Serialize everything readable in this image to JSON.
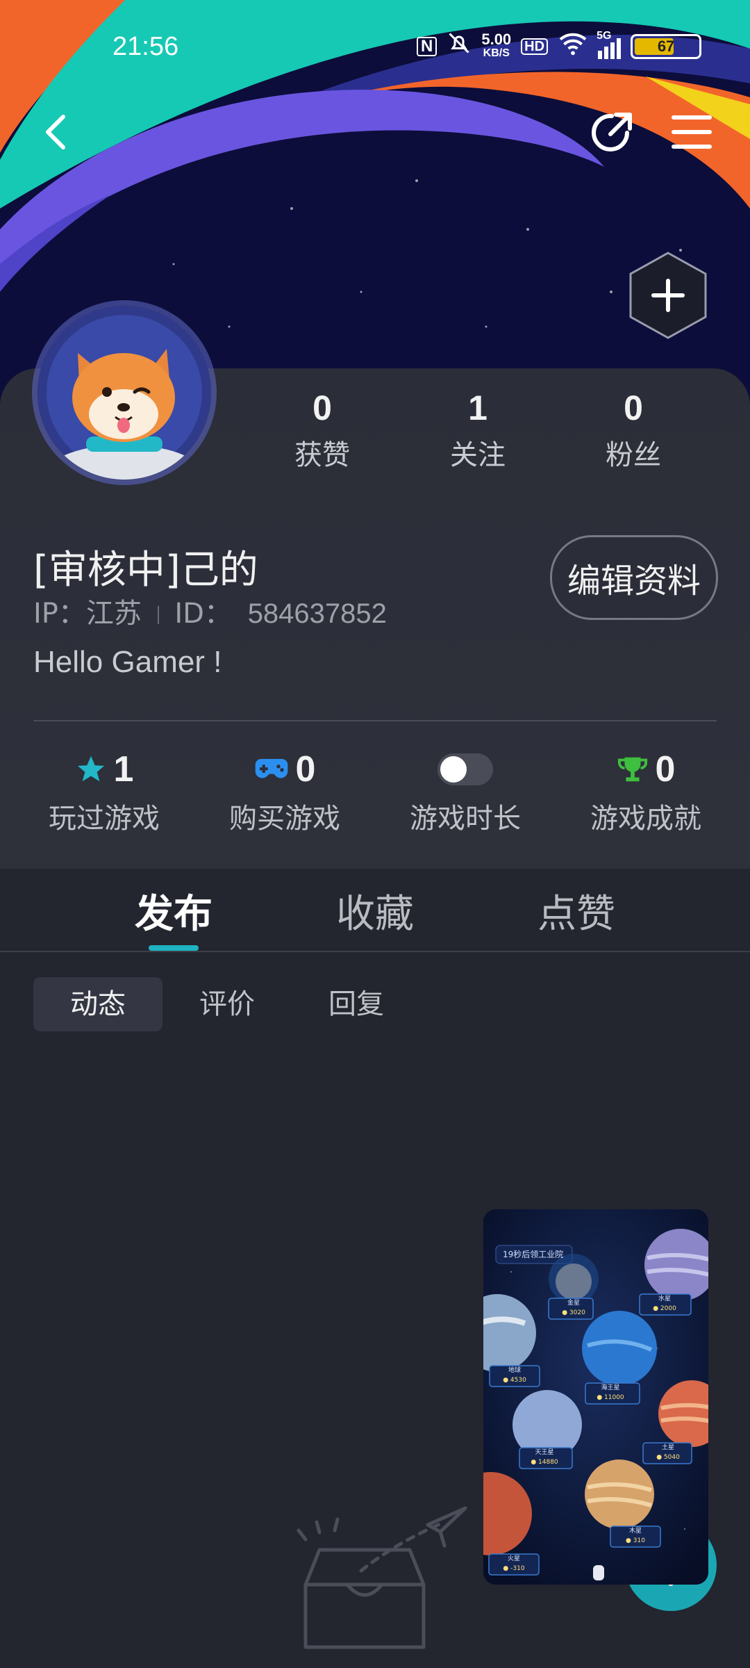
{
  "status_bar": {
    "time": "21:56",
    "nfc": "N",
    "net_speed_value": "5.00",
    "net_speed_unit": "KB/S",
    "hd": "HD",
    "signal_type": "5G",
    "battery": "67",
    "battery_level": 0.67
  },
  "profile": {
    "stats": [
      {
        "num": "0",
        "label": "获赞"
      },
      {
        "num": "1",
        "label": "关注"
      },
      {
        "num": "0",
        "label": "粉丝"
      }
    ],
    "username": "[审核中]己的",
    "ip_label": "IP：江苏",
    "id_label": "ID：",
    "id_value": "584637852",
    "edit_button": "编辑资料",
    "bio": "Hello Gamer !"
  },
  "game_stats": [
    {
      "num": "1",
      "label": "玩过游戏",
      "icon": "star-icon",
      "color": "#22b8c8"
    },
    {
      "num": "0",
      "label": "购买游戏",
      "icon": "gamepad-icon",
      "color": "#2b8ff0"
    },
    {
      "num": "",
      "label": "游戏时长",
      "icon": "toggle",
      "color": "#ffffff"
    },
    {
      "num": "0",
      "label": "游戏成就",
      "icon": "trophy-icon",
      "color": "#3fbf3f"
    }
  ],
  "tabs": [
    "发布",
    "收藏",
    "点赞"
  ],
  "sub_tabs": [
    "动态",
    "评价",
    "回复"
  ],
  "float_window": {
    "header": "19秒后领工业院",
    "planets": [
      {
        "name": "金星",
        "value": "3020"
      },
      {
        "name": "水星",
        "value": "2000"
      },
      {
        "name": "地球",
        "value": "4530"
      },
      {
        "name": "海王星",
        "value": "11000"
      },
      {
        "name": "天王星",
        "value": "14880"
      },
      {
        "name": "土星",
        "value": "5040"
      },
      {
        "name": "木星",
        "value": "310"
      },
      {
        "name": "火星",
        "value": "-310"
      }
    ]
  },
  "colors": {
    "accent": "#1fb3c2",
    "background": "#23252f",
    "panel": "#2c2e39"
  }
}
